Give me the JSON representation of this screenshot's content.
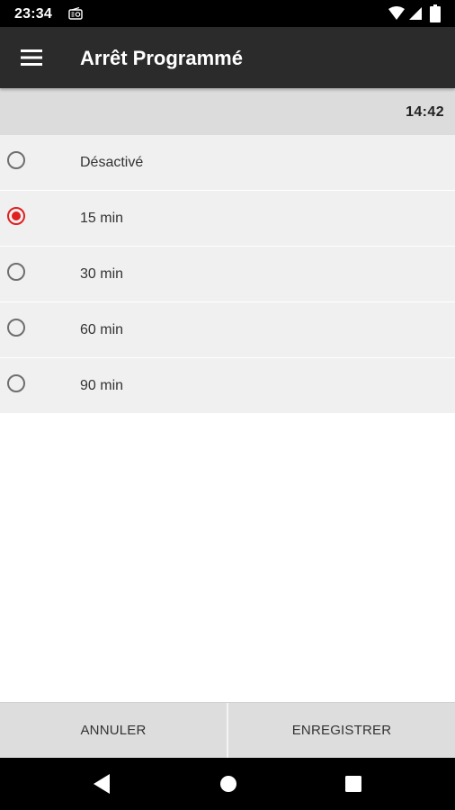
{
  "status_bar": {
    "time": "23:34",
    "icons": [
      "radio-icon",
      "wifi-icon",
      "signal-icon",
      "battery-icon"
    ]
  },
  "app_bar": {
    "menu_icon": "hamburger-menu-icon",
    "title": "Arrêt Programmé"
  },
  "time_bar": {
    "time": "14:42"
  },
  "options": [
    {
      "label": "Désactivé",
      "selected": false
    },
    {
      "label": "15 min",
      "selected": true
    },
    {
      "label": "30 min",
      "selected": false
    },
    {
      "label": "60 min",
      "selected": false
    },
    {
      "label": "90 min",
      "selected": false
    }
  ],
  "buttons": {
    "cancel": "ANNULER",
    "save": "ENREGISTRER"
  },
  "nav_bar": {
    "icons": [
      "back-icon",
      "home-icon",
      "recents-icon"
    ]
  },
  "colors": {
    "accent": "#e02020",
    "app_bar": "#2b2b2b",
    "time_bar": "#dcdcdc",
    "row_background": "#f0f0f0",
    "button_bar": "#dddddd"
  }
}
